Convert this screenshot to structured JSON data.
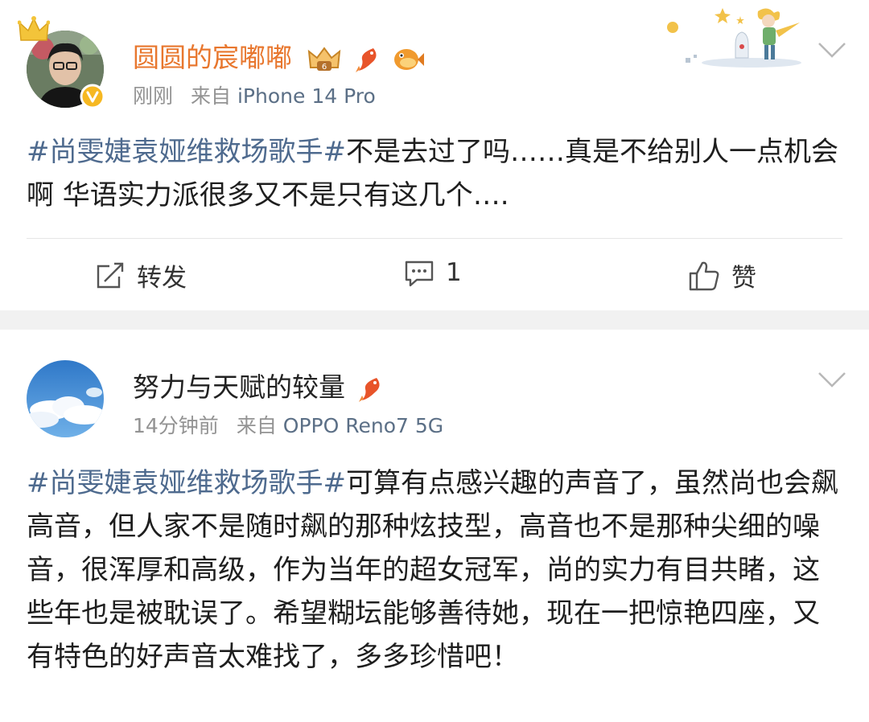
{
  "post1": {
    "user_name": "圆圆的宸嘟嘟",
    "time": "刚刚",
    "source_prefix": "来自",
    "source": "iPhone 14 Pro",
    "hashtag": "#尚雯婕袁娅维救场歌手#",
    "content": "不是去过了吗……真是不给别人一点机会啊 华语实力派很多又不是只有这几个….",
    "actions": {
      "repost": "转发",
      "comment_count": "1",
      "like": "赞"
    },
    "colors": {
      "name": "#e8772e",
      "hashtag": "#4e6a8e"
    }
  },
  "post2": {
    "user_name": "努力与天赋的较量",
    "time": "14分钟前",
    "source_prefix": "来自",
    "source": "OPPO Reno7 5G",
    "hashtag": "#尚雯婕袁娅维救场歌手#",
    "content": "可算有点感兴趣的声音了，虽然尚也会飙高音，但人家不是随时飙的那种炫技型，高音也不是那种尖细的噪音，很浑厚和高级，作为当年的超女冠军，尚的实力有目共睹，这些年也是被耽误了。希望糊坛能够善待她，现在一把惊艳四座，又有特色的好声音太难找了，多多珍惜吧！"
  }
}
